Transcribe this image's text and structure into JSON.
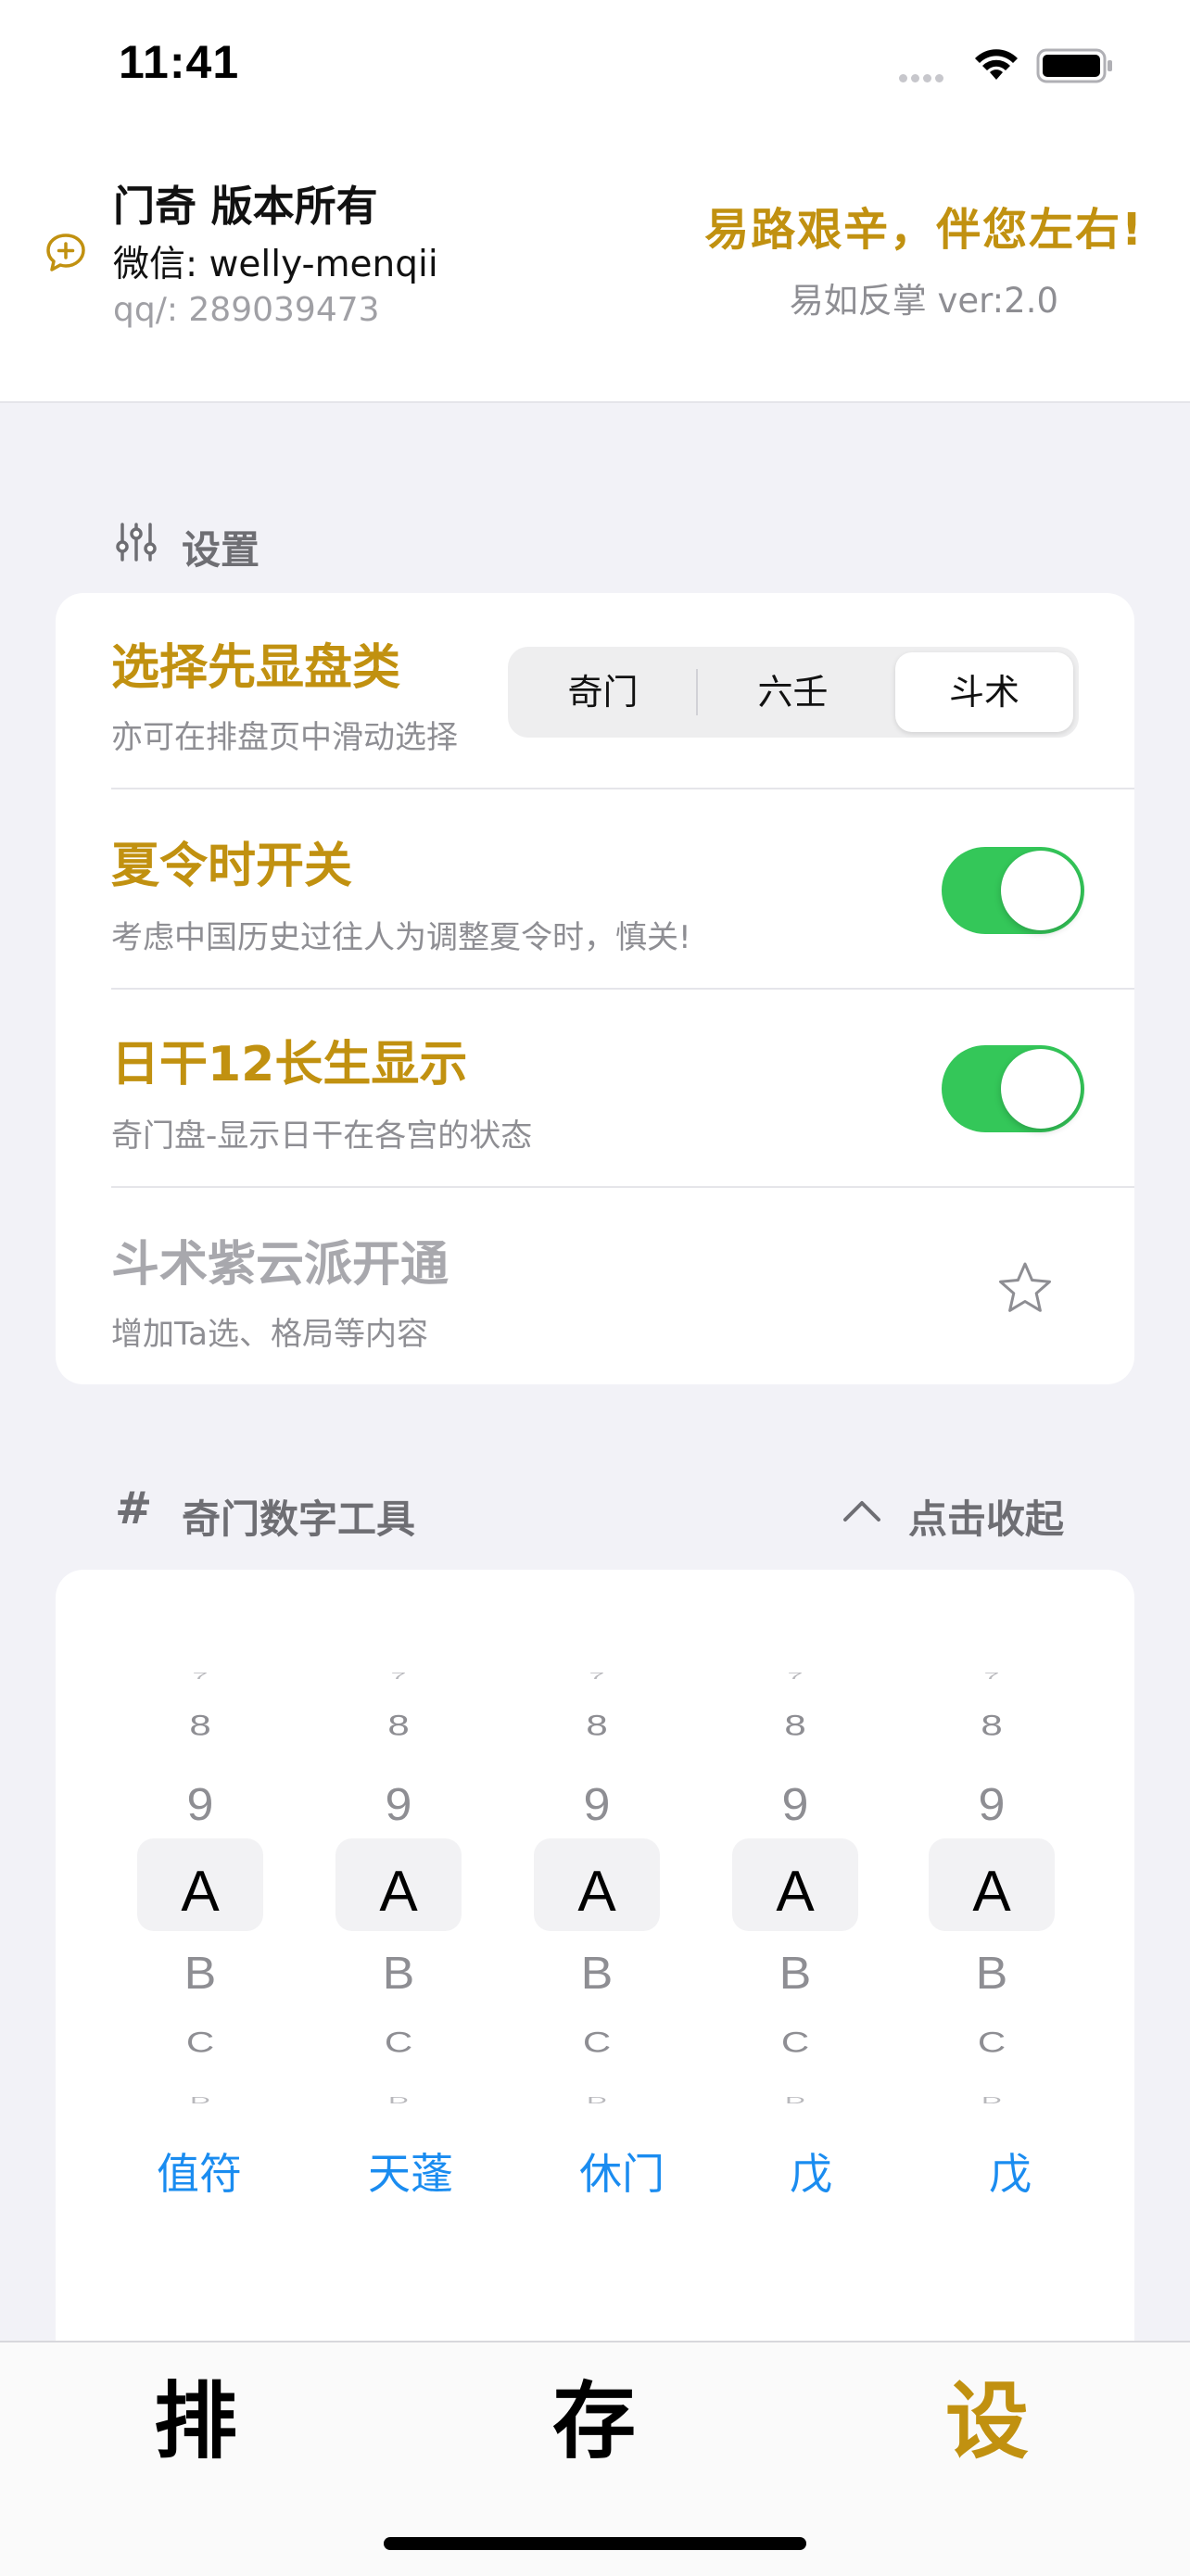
{
  "status": {
    "time": "11:41"
  },
  "header": {
    "title": "门奇 版本所有",
    "wechat": "微信: welly-menqii",
    "qq": "qq/: 289039473",
    "slogan": "易路艰辛，伴您左右!",
    "version": "易如反掌 ver:2.0"
  },
  "settings": {
    "section_label": "设置",
    "rows": [
      {
        "title": "选择先显盘类",
        "subtitle": "亦可在排盘页中滑动选择"
      },
      {
        "title": "夏令时开关",
        "subtitle": "考虑中国历史过往人为调整夏令时，慎关!",
        "toggle_on": true
      },
      {
        "title": "日干12长生显示",
        "subtitle": "奇门盘-显示日干在各宫的状态",
        "toggle_on": true
      },
      {
        "title": "斗术紫云派开通",
        "subtitle": "增加Ta选、格局等内容"
      }
    ],
    "segment": {
      "options": [
        "奇门",
        "六壬",
        "斗术"
      ],
      "selected": "斗术"
    }
  },
  "tools": {
    "section_label": "奇门数字工具",
    "collapse_label": "点击收起",
    "picker_columns": [
      {
        "values": [
          "7",
          "8",
          "9",
          "A",
          "B",
          "C",
          "D"
        ],
        "selected": "A"
      },
      {
        "values": [
          "7",
          "8",
          "9",
          "A",
          "B",
          "C",
          "D"
        ],
        "selected": "A"
      },
      {
        "values": [
          "7",
          "8",
          "9",
          "A",
          "B",
          "C",
          "D"
        ],
        "selected": "A"
      },
      {
        "values": [
          "7",
          "8",
          "9",
          "A",
          "B",
          "C",
          "D"
        ],
        "selected": "A"
      },
      {
        "values": [
          "7",
          "8",
          "9",
          "A",
          "B",
          "C",
          "D"
        ],
        "selected": "A"
      }
    ],
    "result_labels": [
      "值符",
      "天蓬",
      "休门",
      "戊",
      "戊"
    ]
  },
  "tabbar": {
    "tabs": [
      {
        "label": "排",
        "active": false
      },
      {
        "label": "存",
        "active": false
      },
      {
        "label": "设",
        "active": true
      }
    ]
  },
  "colors": {
    "accent": "#c19110",
    "link": "#1a8cf0",
    "toggle_on": "#34c759"
  }
}
